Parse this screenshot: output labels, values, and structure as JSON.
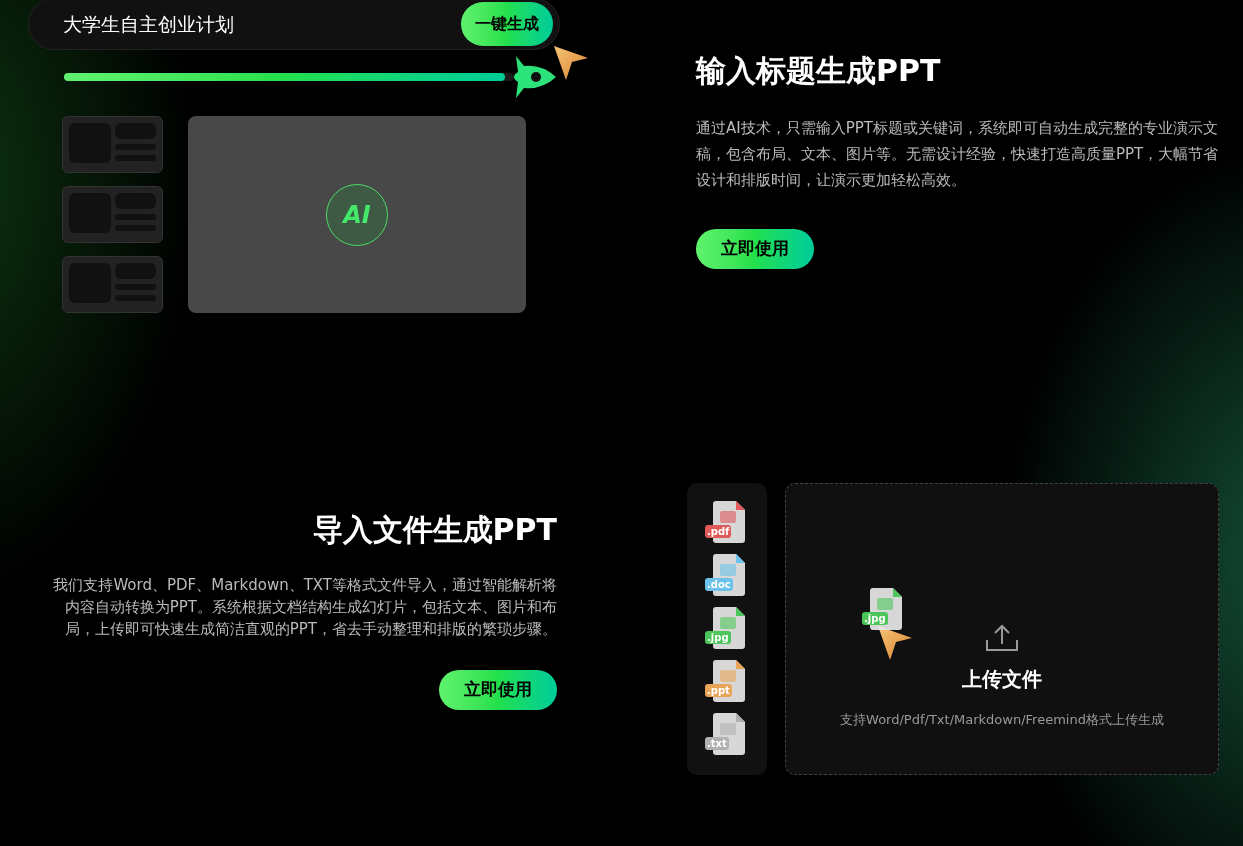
{
  "title_demo": {
    "input_value": "大学生自主创业计划",
    "generate_button": "一键生成",
    "progress": {
      "level": 0.98
    },
    "ai_badge": "AI"
  },
  "title_section": {
    "heading": "输入标题生成PPT",
    "description": "通过AI技术，只需输入PPT标题或关键词，系统即可自动生成完整的专业演示文稿，包含布局、文本、图片等。无需设计经验，快速打造高质量PPT，大幅节省设计和排版时间，让演示更加轻松高效。",
    "button": "立即使用"
  },
  "file_section": {
    "heading": "导入文件生成PPT",
    "description": "我们支持Word、PDF、Markdown、TXT等格式文件导入，通过智能解析将内容自动转换为PPT。系统根据文档结构生成幻灯片，包括文本、图片和布局，上传即可快速生成简洁直观的PPT，省去手动整理和排版的繁琐步骤。",
    "button": "立即使用"
  },
  "file_types": [
    {
      "label": ".pdf",
      "color": "#e05a5a"
    },
    {
      "label": ".doc",
      "color": "#6cc3ea"
    },
    {
      "label": ".jpg",
      "color": "#4cc65a"
    },
    {
      "label": ".ppt",
      "color": "#e8a557"
    },
    {
      "label": ".txt",
      "color": "#b0b0b0"
    }
  ],
  "upload": {
    "dragged_file": {
      "label": ".jpg",
      "color": "#4cc65a"
    },
    "title": "上传文件",
    "hint": "支持Word/Pdf/Txt/Markdown/Freemind格式上传生成"
  }
}
